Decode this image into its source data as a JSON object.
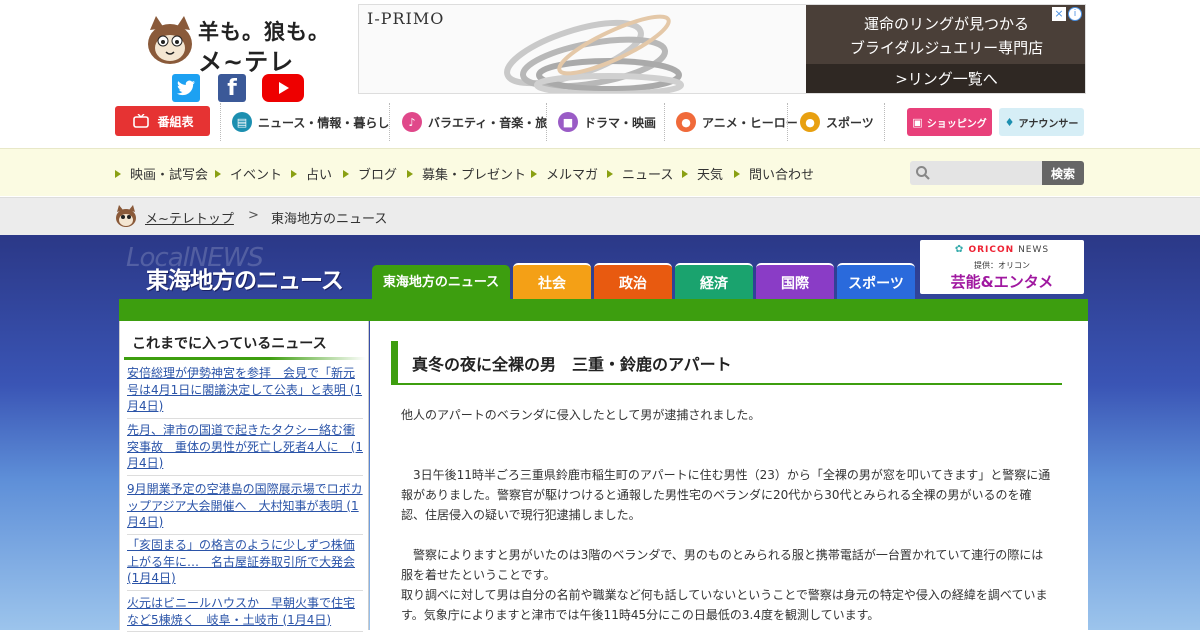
{
  "logo": {
    "line1": "羊も。狼も。",
    "line2": "メ~テレ"
  },
  "social": {
    "twitter": "twitter-icon",
    "facebook": "f",
    "youtube": "youtube-icon"
  },
  "ad": {
    "brand": "I-PRIMO",
    "headline1": "運命のリングが見つかる",
    "headline2": "ブライダルジュエリー専門店",
    "cta": ">リング一覧へ",
    "adchoice": "i",
    "close": "×"
  },
  "global_nav": {
    "bangumi": "番組表",
    "news": "ニュース・情報・暮らし",
    "variety": "バラエティ・音楽・旅",
    "drama": "ドラマ・映画",
    "anime": "アニメ・ヒーロー",
    "sports": "スポーツ",
    "shopping": "ショッピング",
    "announcer": "アナウンサー"
  },
  "sub_nav": [
    "映画・試写会",
    "イベント",
    "占い",
    "ブログ",
    "募集・プレゼント",
    "メルマガ",
    "ニュース",
    "天気",
    "問い合わせ"
  ],
  "search": {
    "placeholder": "",
    "button": "検索"
  },
  "breadcrumb": {
    "home": "メ~テレトップ",
    "sep": ">",
    "current": "東海地方のニュース"
  },
  "section": {
    "ghost": "LocalNEWS",
    "title": "東海地方のニュース"
  },
  "tabs": [
    "東海地方のニュース",
    "社会",
    "政治",
    "経済",
    "国際",
    "スポーツ"
  ],
  "oricon": {
    "brand_a": "ORICON",
    "brand_b": "NEWS",
    "provided": "提供：オリコン",
    "label": "芸能&エンタメ"
  },
  "sidebar": {
    "title": "これまでに入っているニュース",
    "items": [
      "安倍総理が伊勢神宮を参拝　会見で「新元号は4月1日に閣議決定して公表」と表明 (1月4日)",
      "先月、津市の国道で起きたタクシー絡む衝突事故　重体の男性が死亡し死者4人に　(1月4日)",
      "9月開業予定の空港島の国際展示場でロボカップアジア大会開催へ　大村知事が表明 (1月4日)",
      "「亥固まる」の格言のように少しずつ株価上がる年に…　名古屋証券取引所で大発会 (1月4日)",
      "火元はビニールハウスか　早朝火事で住宅など5棟焼く　岐阜・土岐市 (1月4日)"
    ]
  },
  "article": {
    "title": "真冬の夜に全裸の男　三重・鈴鹿のアパート",
    "p1": "他人のアパートのベランダに侵入したとして男が逮捕されました。",
    "p2": "　3日午後11時半ごろ三重県鈴鹿市稲生町のアパートに住む男性（23）から「全裸の男が窓を叩いてきます」と警察に通報がありました。警察官が駆けつけると通報した男性宅のベランダに20代から30代とみられる全裸の男がいるのを確認、住居侵入の疑いで現行犯逮捕しました。",
    "p3": "　警察によりますと男がいたのは3階のベランダで、男のものとみられる服と携帯電話が一台置かれていて連行の際には服を着せたということです。",
    "p4": "取り調べに対して男は自分の名前や職業など何も話していないということで警察は身元の特定や侵入の経緯を調べています。気象庁によりますと津市では午後11時45分にこの日最低の3.4度を観測しています。"
  },
  "colors": {
    "accent_green": "#3d9e0f",
    "bangumi_red": "#e63333",
    "link_blue": "#2b54a8",
    "band_navy": "#2b3887"
  }
}
